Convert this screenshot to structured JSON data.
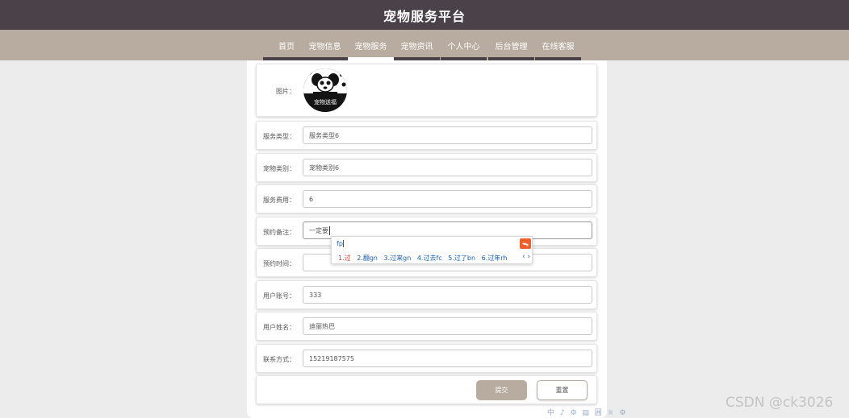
{
  "app": {
    "title": "宠物服务平台"
  },
  "nav": {
    "items": [
      {
        "label": "首页",
        "active": false
      },
      {
        "label": "宠物信息",
        "active": false
      },
      {
        "label": "宠物服务",
        "active": true
      },
      {
        "label": "宠物资讯",
        "active": false
      },
      {
        "label": "个人中心",
        "active": false
      },
      {
        "label": "后台管理",
        "active": false
      },
      {
        "label": "在线客服",
        "active": false
      }
    ]
  },
  "form": {
    "image_label": "图片：",
    "image_caption": "宠物送福",
    "service_type": {
      "label": "服务类型：",
      "value": "服务类型6"
    },
    "pet_category": {
      "label": "宠物类别：",
      "value": "宠物类别6"
    },
    "service_fee": {
      "label": "服务费用：",
      "value": "6"
    },
    "booking_note": {
      "label": "预约备注：",
      "value": "一定要"
    },
    "booking_time": {
      "label": "预约时间：",
      "value": ""
    },
    "user_account": {
      "label": "用户账号：",
      "value": "333"
    },
    "user_name": {
      "label": "用户姓名：",
      "value": "迪丽热巴"
    },
    "contact": {
      "label": "联系方式：",
      "value": "15219187575"
    },
    "submit_label": "提交",
    "reset_label": "重置"
  },
  "ime": {
    "pinyin": "fp",
    "candidates": [
      "1.过",
      "2.翻gn",
      "3.过来gn",
      "4.过去fc",
      "5.过了bn",
      "6.过年rh"
    ],
    "more": "‹ ›"
  },
  "watermark": "CSDN @ck3026",
  "tray": "中 ♪ ⚙ ▤ 囲 ♕ ⚙",
  "colors": {
    "topbar": "#4a4149",
    "navbar": "#b8ab9f",
    "accent": "#b8ab9f",
    "ime_logo": "#ef5f2b"
  }
}
